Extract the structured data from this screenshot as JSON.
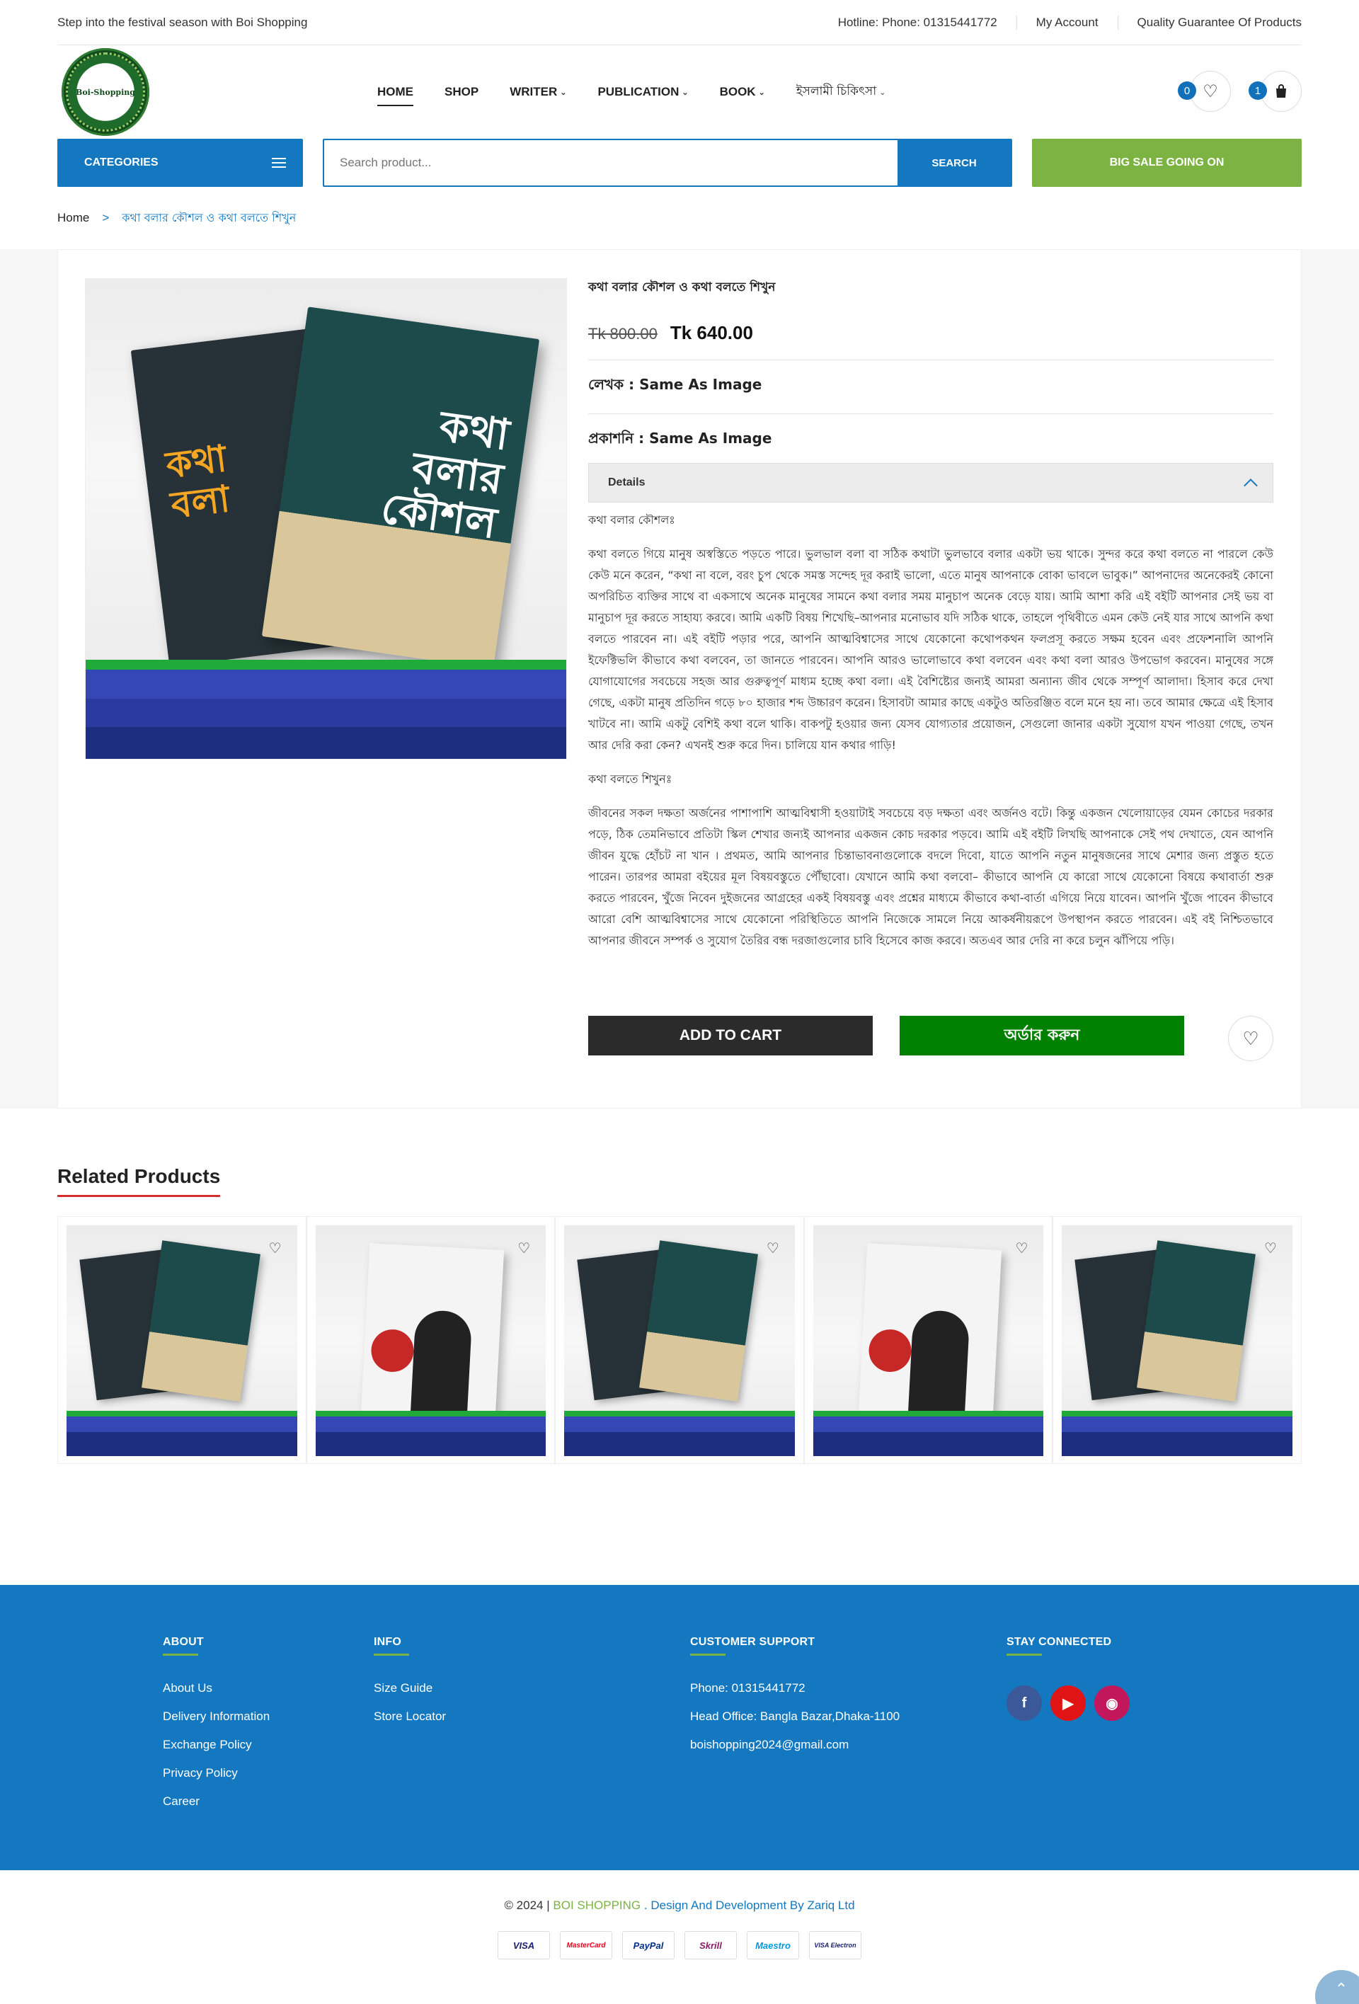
{
  "topbar": {
    "promo": "Step into the festival season with Boi Shopping",
    "hotline": "Hotline: Phone: 01315441772",
    "account": "My Account",
    "guarantee": "Quality Guarantee Of Products"
  },
  "logo": {
    "text": "Boi-Shopping"
  },
  "nav": [
    {
      "label": "HOME",
      "dropdown": false
    },
    {
      "label": "SHOP",
      "dropdown": false
    },
    {
      "label": "WRITER",
      "dropdown": true
    },
    {
      "label": "PUBLICATION",
      "dropdown": true
    },
    {
      "label": "BOOK",
      "dropdown": true
    },
    {
      "label": "ইসলামী চিকিৎসা",
      "dropdown": true
    }
  ],
  "header": {
    "wishlist_count": "0",
    "cart_count": "1"
  },
  "search": {
    "categories_label": "CATEGORIES",
    "placeholder": "Search product...",
    "button": "SEARCH",
    "sale": "BIG SALE GOING ON"
  },
  "breadcrumb": {
    "home": "Home",
    "sep": ">",
    "current": "কথা বলার কৌশল ও কথা বলতে শিখুন"
  },
  "product": {
    "title": "কথা বলার কৌশল ও কথা বলতে শিখুন",
    "old_price": "Tk 800.00",
    "new_price": "Tk 640.00",
    "author": "লেখক : Same As Image",
    "publisher": "প্রকাশনি : Same As Image",
    "details_label": "Details",
    "desc_h1": "কথা বলার কৌশলঃ",
    "desc_p1": "কথা বলতে গিয়ে মানুষ অস্বস্তিতে পড়তে পারে। ভুলভাল বলা বা সঠিক কথাটা ভুলভাবে বলার একটা ভয় থাকে। সুন্দর করে কথা বলতে না পারলে কেউ কেউ মনে করেন, “কথা না বলে, বরং চুপ থেকে সমস্ত সন্দেহ দূর করাই ভালো, এতে মানুষ আপনাকে বোকা ভাবলে ভাবুক।” আপনাদের অনেকেরই কোনো অপরিচিত ব্যক্তির সাথে বা একসাথে অনেক মানুষের সামনে কথা বলার সময় মানুচাপ অনেক বেড়ে যায়। আমি আশা করি এই বইটি আপনার সেই ভয় বা মানুচাপ দূর করতে সাহায্য করবে। আমি একটি বিষয় শিখেছি–আপনার মনোভাব যদি সঠিক থাকে, তাহলে পৃথিবীতে এমন কেউ নেই যার সাথে আপনি কথা বলতে পারবেন না। এই বইটি পড়ার পরে, আপনি আত্মবিশ্বাসের সাথে যেকোনো কথোপকথন ফলপ্রসূ করতে সক্ষম হবেন এবং প্রফেশনালি আপনি ইফেক্টিভলি কীভাবে কথা বলবেন, তা জানতে পারবেন। আপনি আরও ভালোভাবে কথা বলবেন এবং কথা বলা আরও উপভোগ করবেন। মানুষের সঙ্গে যোগাযোগের সবচেয়ে সহজ আর গুরুত্বপূর্ণ মাধ্যম হচ্ছে কথা বলা। এই বৈশিষ্ট্যের জন্যই আমরা অন্যান্য জীব থেকে সম্পূর্ণ আলাদা। হিসাব করে দেখা গেছে, একটা মানুষ প্রতিদিন গড়ে ৮০ হাজার শব্দ উচ্চারণ করেন। হিসাবটা আমার কাছে একটুও অতিরঞ্জিত বলে মনে হয় না। তবে আমার ক্ষেত্রে এই হিসাব খাটবে না। আমি একটু বেশিই কথা বলে থাকি। বাকপটু হওয়ার জন্য যেসব যোগ্যতার প্রয়োজন, সেগুলো জানার একটা সুযোগ যখন পাওয়া গেছে, তখন আর দেরি করা কেন? এখনই শুরু করে দিন। চালিয়ে যান কথার গাড়ি!",
    "desc_h2": "কথা বলতে শিখুনঃ",
    "desc_p2": "জীবনের সকল দক্ষতা অর্জনের পাশাপাশি আত্মবিশ্বাসী হওয়াটাই সবচেয়ে বড় দক্ষতা এবং অর্জনও বটে। কিন্তু একজন খেলোয়াড়ের যেমন কোচের দরকার পড়ে, ঠিক তেমনিভাবে প্রতিটা স্কিল শেখার জন্যই আপনার একজন কোচ দরকার পড়বে। আমি এই বইটি লিখছি আপনাকে সেই পথ দেখাতে, যেন আপনি জীবন যুদ্ধে হোঁচট না খান । প্রথমত, আমি আপনার চিন্তাভাবনাগুলোকে বদলে দিবো, যাতে আপনি নতুন মানুষজনের সাথে মেশার জন্য প্রস্তুত হতে পারেন। তারপর আমরা বইয়ের মূল বিষয়বস্তুতে পৌঁছাবো। যেখানে আমি কথা বলবো– কীভাবে আপনি যে কারো সাথে যেকোনো বিষয়ে কথাবার্তা শুরু করতে পারবেন, খুঁজে নিবেন দুইজনের আগ্রহের একই বিষয়বস্তু এবং প্রশ্নের মাধ্যমে কীভাবে কথা-বার্তা এগিয়ে নিয়ে যাবেন। আপনি খুঁজে পাবেন কীভাবে আরো বেশি আত্মবিশ্বাসের সাথে যেকোনো পরিস্থিতিতে আপনি নিজেকে সামলে নিয়ে আকর্ষনীয়রূপে উপস্থাপন করতে পারবেন। এই বই নিশ্চিতভাবে আপনার জীবনে সম্পর্ক ও সুযোগ তৈরির বন্ধ দরজাগুলোর চাবি হিসেবে কাজ করবে। অতএব আর দেরি না করে চলুন ঝাঁপিয়ে পড়ি।",
    "add_to_cart": "ADD TO CART",
    "order": "অর্ডার করুন"
  },
  "related": {
    "title": "Related Products",
    "items": [
      {
        "type": "kotha"
      },
      {
        "type": "campus"
      },
      {
        "type": "kotha"
      },
      {
        "type": "campus"
      },
      {
        "type": "kotha"
      }
    ]
  },
  "footer": {
    "about": {
      "title": "ABOUT",
      "links": [
        "About Us",
        "Delivery Information",
        "Exchange Policy",
        "Privacy Policy",
        "Career"
      ]
    },
    "info": {
      "title": "INFO",
      "links": [
        "Size Guide",
        "Store Locator"
      ]
    },
    "support": {
      "title": "CUSTOMER SUPPORT",
      "lines": [
        "Phone: 01315441772",
        "Head Office: Bangla Bazar,Dhaka-1100",
        "boishopping2024@gmail.com"
      ]
    },
    "stay": {
      "title": "STAY CONNECTED"
    }
  },
  "copyright": {
    "prefix": "© 2024 |",
    "brand": "BOI SHOPPING",
    "dot": ".",
    "credit": "Design And Development By Zariq Ltd"
  },
  "payments": [
    "VISA",
    "MasterCard",
    "PayPal",
    "Skrill",
    "Maestro",
    "VISA Electron"
  ],
  "colors": {
    "primary": "#1378c0",
    "green": "#7cb342",
    "order": "#008000",
    "dark": "#2b2b2b"
  }
}
